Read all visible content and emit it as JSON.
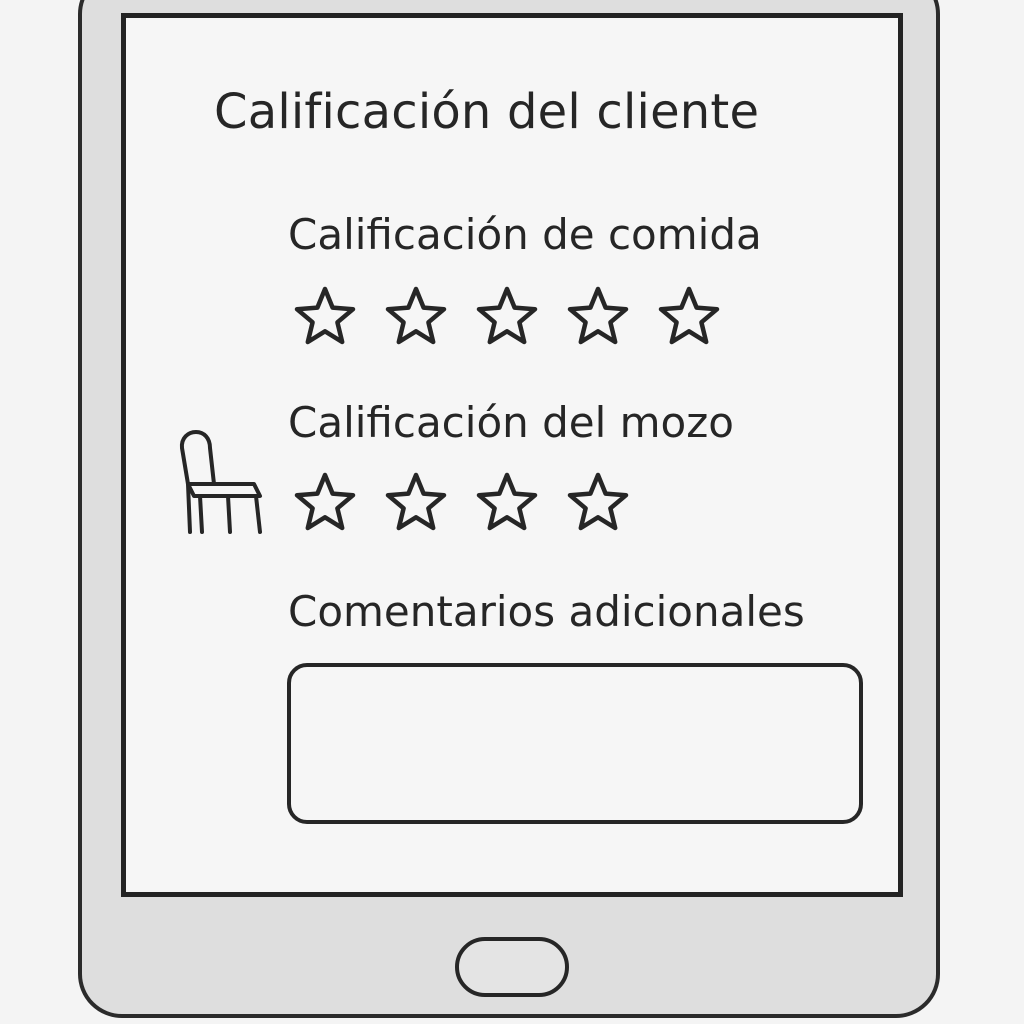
{
  "form": {
    "title": "Calificación del cliente",
    "food_rating": {
      "label": "Calificación de comida",
      "stars_shown": 5,
      "selected": 0
    },
    "waiter_rating": {
      "label": "Calificación del mozo",
      "stars_shown": 4,
      "selected": 0
    },
    "comments": {
      "label": "Comentarios adicionales",
      "value": ""
    }
  },
  "icons": {
    "star": "star-outline-icon",
    "chair": "chair-icon"
  },
  "colors": {
    "outline": "#262626",
    "device_body": "#dedede",
    "screen_background": "#f6f6f6",
    "page_background": "#f4f4f4"
  }
}
